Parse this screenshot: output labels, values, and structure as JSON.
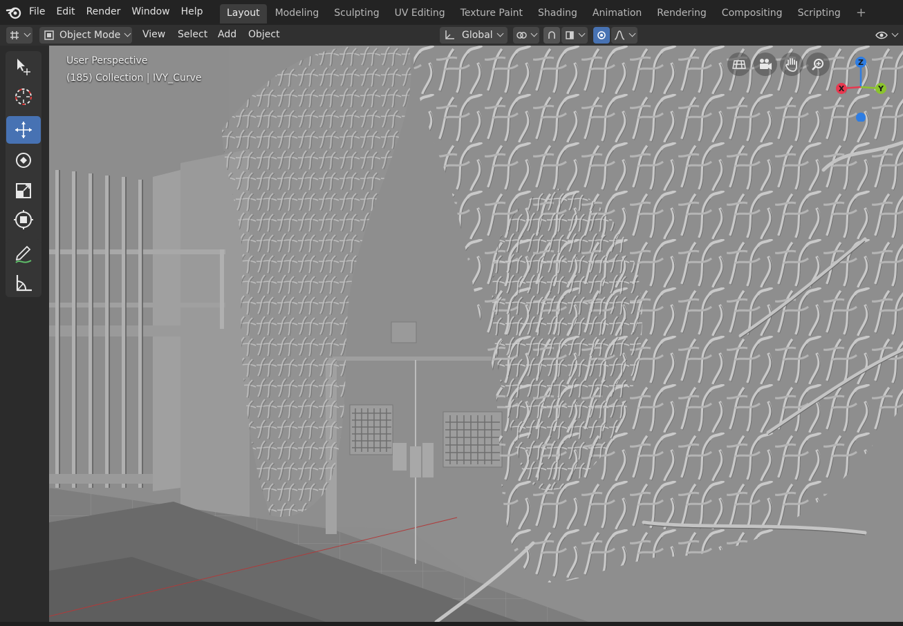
{
  "menu": [
    "File",
    "Edit",
    "Render",
    "Window",
    "Help"
  ],
  "tabs": [
    {
      "label": "Layout",
      "active": true
    },
    {
      "label": "Modeling"
    },
    {
      "label": "Sculpting"
    },
    {
      "label": "UV Editing"
    },
    {
      "label": "Texture Paint"
    },
    {
      "label": "Shading"
    },
    {
      "label": "Animation"
    },
    {
      "label": "Rendering"
    },
    {
      "label": "Compositing"
    },
    {
      "label": "Scripting"
    }
  ],
  "tab_add": "+",
  "header": {
    "mode": "Object Mode",
    "menus": [
      "View",
      "Select",
      "Add",
      "Object"
    ],
    "orientation": "Global"
  },
  "viewport": {
    "perspective": "User Perspective",
    "collection": "(185) Collection | IVY_Curve"
  },
  "gizmo": {
    "x": "X",
    "y": "Y",
    "z": "Z"
  },
  "colors": {
    "accent": "#4772b3",
    "axis_x": "#e8384f",
    "axis_y": "#8bc42c",
    "axis_z": "#2e7de3"
  },
  "icons": [
    "blender-logo-icon",
    "editor-type-icon",
    "select-tool-icon",
    "cursor-tool-icon",
    "move-tool-icon",
    "rotate-tool-icon",
    "scale-tool-icon",
    "transform-tool-icon",
    "annotate-tool-icon",
    "measure-tool-icon",
    "grid-icon",
    "camera-icon",
    "hand-icon",
    "zoom-icon",
    "visibility-icon"
  ]
}
